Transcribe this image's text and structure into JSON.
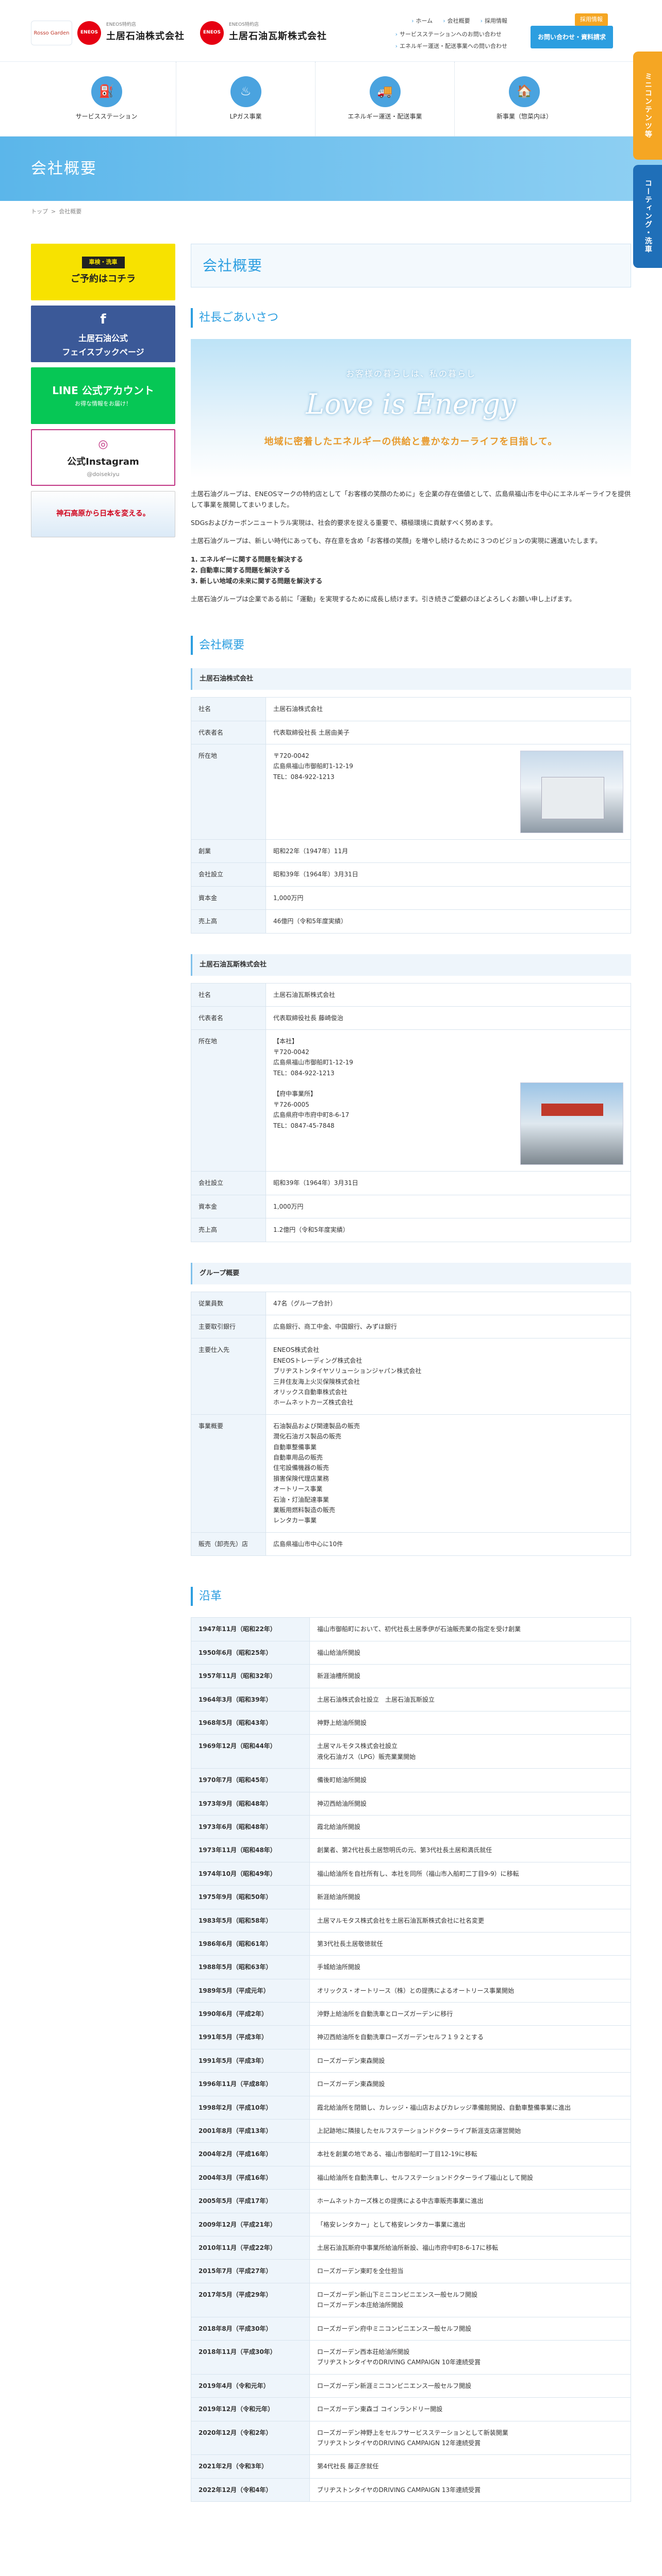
{
  "header": {
    "logo_badge": "Rosso Garden",
    "eneos1": "ENEOS",
    "brand1_sub": "ENEOS特約店",
    "brand1_name": "土居石油株式会社",
    "eneos2": "ENEOS",
    "brand2_sub": "ENEOS特約店",
    "brand2_name": "土居石油瓦斯株式会社",
    "links": [
      "ホーム",
      "会社概要",
      "採用情報"
    ],
    "sub_links": [
      "サービスステーションへのお問い合わせ",
      "エネルギー運送・配送事業への問い合わせ"
    ],
    "recruit": "採用情報",
    "contact": "お問い合わせ・資料請求"
  },
  "side_tabs": [
    "ミニコンテンツ等",
    "コーティング・洗車"
  ],
  "nav": [
    {
      "label": "サービスステーション",
      "icon": "⛽"
    },
    {
      "label": "LPガス事業",
      "icon": "♨"
    },
    {
      "label": "エネルギー運送・配送事業",
      "icon": "🚚"
    },
    {
      "label": "新事業（惣菜内ほ）",
      "icon": "🏠"
    }
  ],
  "page_title": "会社概要",
  "breadcrumb": {
    "home": "トップ",
    "current": "会社概要"
  },
  "sidebar": {
    "yellow_top": "車検・洗車",
    "yellow_main": "ご予約はコチラ",
    "fb_line1": "土居石油公式",
    "fb_line2": "フェイスブックページ",
    "line_main": "LINE 公式アカウント",
    "line_sub": "お得な情報をお届け！",
    "insta_main": "公式Instagram",
    "insta_sub": "@doisekiyu",
    "dream": "神石高原から日本を変える。"
  },
  "main": {
    "title": "会社概要",
    "greeting_heading": "社長ごあいさつ",
    "hero_sub": "お客様の暮らしは、私の暮らし",
    "hero_main": "Love is Energy",
    "hero_caption": "地域に密着したエネルギーの供給と豊かなカーライフを目指して。",
    "greeting_p1": "土居石油グループは、ENEOSマークの特約店として「お客様の笑顔のために」を企業の存在価値として、広島県福山市を中心にエネルギーライフを提供して事業を展開してまいりました。",
    "greeting_p2": "SDGsおよびカーボンニュートラル実現は、社会的要求を捉える重要で、積極環境に貢献すべく努めます。",
    "greeting_p3": "土居石油グループは、新しい時代にあっても、存在意を含め「お客様の笑顔」を増やし続けるために３つのビジョンの実現に邁進いたします。",
    "visions": [
      "1. エネルギーに関する問題を解決する",
      "2. 自動車に関する問題を解決する",
      "3. 新しい地域の未来に関する問題を解決する"
    ],
    "greeting_p4": "土居石油グループは企業である前に「運動」を実現するために成長し続けます。引き続きご愛顧のほどよろしくお願い申し上げます。",
    "overview_heading": "会社概要",
    "company1": {
      "name_heading": "土居石油株式会社",
      "rows": [
        {
          "th": "社名",
          "td": "土居石油株式会社"
        },
        {
          "th": "代表者名",
          "td": "代表取締役社長 土居由美子"
        },
        {
          "th": "所在地",
          "td": "〒720-0042\n広島県福山市御船町1-12-19\nTEL：084-922-1213"
        },
        {
          "th": "創業",
          "td": "昭和22年（1947年）11月"
        },
        {
          "th": "会社設立",
          "td": "昭和39年（1964年）3月31日"
        },
        {
          "th": "資本金",
          "td": "1,000万円"
        },
        {
          "th": "売上高",
          "td": "46億円（令和5年度実績）"
        }
      ]
    },
    "company2": {
      "name_heading": "土居石油瓦斯株式会社",
      "rows": [
        {
          "th": "社名",
          "td": "土居石油瓦斯株式会社"
        },
        {
          "th": "代表者名",
          "td": "代表取締役社長 藤崎俊治"
        },
        {
          "th": "所在地",
          "td": "【本社】\n〒720-0042\n広島県福山市御船町1-12-19\nTEL：084-922-1213\n\n【府中事業所】\n〒726-0005\n広島県府中市府中町8-6-17\nTEL：0847-45-7848"
        },
        {
          "th": "会社設立",
          "td": "昭和39年（1964年）3月31日"
        },
        {
          "th": "資本金",
          "td": "1,000万円"
        },
        {
          "th": "売上高",
          "td": "1.2億円（令和5年度実績）"
        }
      ]
    },
    "group": {
      "heading": "グループ概要",
      "rows": [
        {
          "th": "従業員数",
          "td": "47名（グループ合計）"
        },
        {
          "th": "主要取引銀行",
          "td": "広島銀行、商工中金、中国銀行、みずほ銀行"
        },
        {
          "th": "主要仕入先",
          "td": "ENEOS株式会社\nENEOSトレーディング株式会社\nブリヂストンタイヤソリューションジャパン株式会社\n三井住友海上火災保険株式会社\nオリックス自動車株式会社\nホームネットカーズ株式会社"
        },
        {
          "th": "事業概要",
          "td": "石油製品および関連製品の販売\n潤化石油ガス製品の販売\n自動車整備事業\n自動車用品の販売\n住宅設備機器の販売\n損害保険代理店業務\nオートリース事業\n石油・灯油配達事業\n業販用燃料製造の販売\nレンタカー事業"
        },
        {
          "th": "販売（卸売先）店",
          "td": "広島県福山市中心に10件"
        }
      ]
    },
    "history_heading": "沿革",
    "history": [
      {
        "date": "1947年11月（昭和22年）",
        "event": "福山市御船町において、初代社長土居季伊が石油販売業の指定を受け創業"
      },
      {
        "date": "1950年6月（昭和25年）",
        "event": "福山給油所開設"
      },
      {
        "date": "1957年11月（昭和32年）",
        "event": "新涯油槽所開設"
      },
      {
        "date": "1964年3月（昭和39年）",
        "event": "土居石油株式会社設立　土居石油瓦斯設立"
      },
      {
        "date": "1968年5月（昭和43年）",
        "event": "神野上給油所開設"
      },
      {
        "date": "1969年12月（昭和44年）",
        "event": "土居マルモタス株式会社設立\n液化石油ガス（LPG）販売業業開始"
      },
      {
        "date": "1970年7月（昭和45年）",
        "event": "備後町給油所開設"
      },
      {
        "date": "1973年9月（昭和48年）",
        "event": "神辺西給油所開設"
      },
      {
        "date": "1973年6月（昭和48年）",
        "event": "霞北給油所開設"
      },
      {
        "date": "1973年11月（昭和48年）",
        "event": "創業者、第2代社長土居惣明氏の元、第3代社長土居和満氏就任"
      },
      {
        "date": "1974年10月（昭和49年）",
        "event": "福山給油所を自社所有し、本社を同所（福山市入船町二丁目9-9）に移転"
      },
      {
        "date": "1975年9月（昭和50年）",
        "event": "新涯給油所開設"
      },
      {
        "date": "1983年5月（昭和58年）",
        "event": "土居マルモタス株式会社を土居石油瓦斯株式会社に社名変更"
      },
      {
        "date": "1986年6月（昭和61年）",
        "event": "第3代社長土居敬徳就任"
      },
      {
        "date": "1988年5月（昭和63年）",
        "event": "手城給油所開設"
      },
      {
        "date": "1989年5月（平成元年）",
        "event": "オリックス・オートリース（株）との提携によるオートリース事業開始"
      },
      {
        "date": "1990年6月（平成2年）",
        "event": "沖野上給油所を自動洗車とローズガーデンに移行"
      },
      {
        "date": "1991年5月（平成3年）",
        "event": "神辺西給油所を自動洗車ローズガーデンセルフ１９２とする"
      },
      {
        "date": "1991年5月（平成3年）",
        "event": "ローズガーデン東森開設"
      },
      {
        "date": "1996年11月（平成8年）",
        "event": "ローズガーデン東森開設"
      },
      {
        "date": "1998年2月（平成10年）",
        "event": "霞北給油所を閉鎖し、カレッジ・福山店およびカレッジ準備館開設、自動車整備事業に進出"
      },
      {
        "date": "2001年8月（平成13年）",
        "event": "上記跡地に隣接したセルフステーションドクターライブ新涯支店運営開始"
      },
      {
        "date": "2004年2月（平成16年）",
        "event": "本社を創業の地である、福山市御船町一丁目12-19に移転"
      },
      {
        "date": "2004年3月（平成16年）",
        "event": "福山給油所を自動洗車し、セルフステーションドクターライブ福山として開設"
      },
      {
        "date": "2005年5月（平成17年）",
        "event": "ホームネットカーズ株との提携による中古車販売事業に進出"
      },
      {
        "date": "2009年12月（平成21年）",
        "event": "「格安レンタカー」として格安レンタカー事業に進出"
      },
      {
        "date": "2010年11月（平成22年）",
        "event": "土居石油瓦斯府中事業所給油所新設、福山市府中町8-6-17に移転"
      },
      {
        "date": "2015年7月（平成27年）",
        "event": "ローズガーデン東町を全仕担当"
      },
      {
        "date": "2017年5月（平成29年）",
        "event": "ローズガーデン新山下ミニコンビニエンス一般セルフ開設\nローズガーデン本庄給油所開設"
      },
      {
        "date": "2018年8月（平成30年）",
        "event": "ローズガーデン府中ミニコンビニエンス一般セルフ開設"
      },
      {
        "date": "2018年11月（平成30年）",
        "event": "ローズガーデン西本荘給油所開設\nブリヂストンタイヤのDRIVING CAMPAIGN 10年連続受賞"
      },
      {
        "date": "2019年4月（令和元年）",
        "event": "ローズガーデン新涯ミニコンビニエンス一般セルフ開設"
      },
      {
        "date": "2019年12月（令和元年）",
        "event": "ローズガーデン東森ゴ コインランドリー開設"
      },
      {
        "date": "2020年12月（令和2年）",
        "event": "ローズガーデン神野上をセルフサービスステーションとして新装開業\nブリヂストンタイヤのDRIVING CAMPAIGN 12年連続受賞"
      },
      {
        "date": "2021年2月（令和3年）",
        "event": "第4代社長 藤正彦就任"
      },
      {
        "date": "2022年12月（令和4年）",
        "event": "ブリヂストンタイヤのDRIVING CAMPAIGN 13年連続受賞"
      }
    ]
  }
}
